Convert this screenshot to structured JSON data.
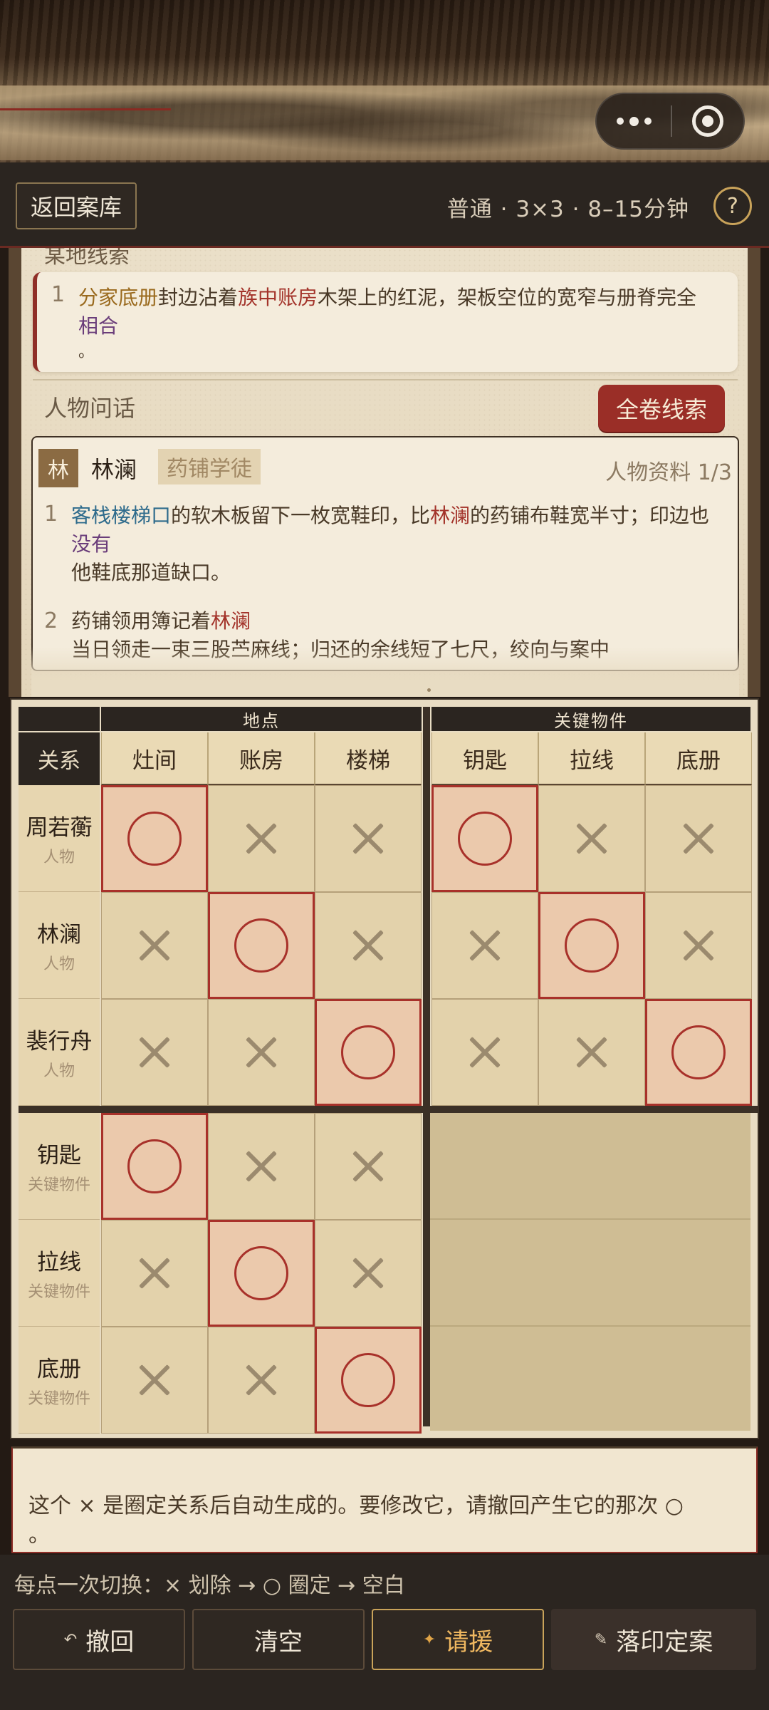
{
  "header": {
    "back_label": "返回案库",
    "meta": "普通 · 3×3 · 8–15分钟",
    "help_label": "?"
  },
  "evidence": {
    "cut_heading": "某地线索",
    "item_number": "1",
    "line1_a": "分家底册",
    "line1_b": "封边沾着",
    "line1_c": "族中账房",
    "line1_d": "木架上的红泥，架板空位的宽窄与册脊完全",
    "line2": "相合",
    "line3": "。"
  },
  "section": {
    "title": "人物问话",
    "all_clues_label": "全卷线索"
  },
  "character": {
    "badge": "林",
    "name": "林澜",
    "role": "药铺学徒",
    "count": "人物资料 1/3",
    "clues": [
      {
        "number": "1",
        "line1_a": "客栈楼梯口",
        "line1_b": "的软木板留下一枚宽鞋印，比",
        "line1_c": "林澜",
        "line1_d": "的药铺布鞋宽半寸；印边也",
        "line2": "没有",
        "line3": "他鞋底那道缺口。"
      },
      {
        "number": "2",
        "line1_a": "药铺领用簿记着",
        "line1_b": "林澜",
        "line2": "当日领走一束三股苎麻线；归还的余线短了七尺，绞向与案中"
      }
    ]
  },
  "grid": {
    "corner_label": "关系",
    "categories": [
      "地点",
      "关键物件"
    ],
    "columns": [
      "灶间",
      "账房",
      "楼梯",
      "钥匙",
      "拉线",
      "底册"
    ],
    "rows": [
      {
        "name": "周若蘅",
        "type": "人物"
      },
      {
        "name": "林澜",
        "type": "人物"
      },
      {
        "name": "裴行舟",
        "type": "人物"
      },
      {
        "name": "钥匙",
        "type": "关键物件"
      },
      {
        "name": "拉线",
        "type": "关键物件"
      },
      {
        "name": "底册",
        "type": "关键物件"
      }
    ],
    "cells": [
      [
        "O",
        "X",
        "X",
        "O",
        "X",
        "X"
      ],
      [
        "X",
        "O",
        "X",
        "X",
        "O",
        "X"
      ],
      [
        "X",
        "X",
        "O",
        "X",
        "X",
        "O"
      ],
      [
        "O",
        "X",
        "X",
        "",
        "",
        ""
      ],
      [
        "X",
        "O",
        "X",
        "",
        "",
        ""
      ],
      [
        "X",
        "X",
        "O",
        "",
        "",
        ""
      ]
    ]
  },
  "message": {
    "line1": "这个 × 是圈定关系后自动生成的。要修改它，请撤回产生它的那次 ○",
    "line2": "。"
  },
  "footer": {
    "hint": "每点一次切换：× 划除 → ○ 圈定 → 空白",
    "undo_label": "撤回",
    "clear_label": "清空",
    "help_label": "请援",
    "seal_label": "落印定案"
  },
  "colors": {
    "accent_red": "#9a2e27",
    "gold": "#c9a35a",
    "parchment": "#e8dcc3"
  }
}
